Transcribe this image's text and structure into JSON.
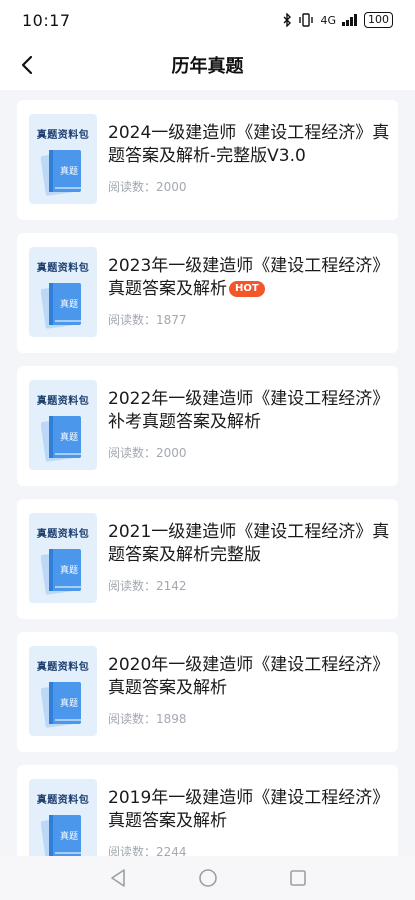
{
  "status_bar": {
    "time": "10:17",
    "network": "4G",
    "battery": "100"
  },
  "header": {
    "title": "历年真题",
    "back_icon": "chevron-left-icon"
  },
  "thumbnail": {
    "label": "真题资料包",
    "book_text": "真题"
  },
  "read_prefix": "阅读数：",
  "hot_label": "HOT",
  "items": [
    {
      "title": "2024一级建造师《建设工程经济》真题答案及解析-完整版V3.0",
      "reads": "2000",
      "hot": false
    },
    {
      "title": "2023年一级建造师《建设工程经济》真题答案及解析",
      "reads": "1877",
      "hot": true
    },
    {
      "title": "2022年一级建造师《建设工程经济》补考真题答案及解析",
      "reads": "2000",
      "hot": false
    },
    {
      "title": "2021一级建造师《建设工程经济》真题答案及解析完整版",
      "reads": "2142",
      "hot": false
    },
    {
      "title": "2020年一级建造师《建设工程经济》真题答案及解析",
      "reads": "1898",
      "hot": false
    },
    {
      "title": "2019年一级建造师《建设工程经济》真题答案及解析",
      "reads": "2244",
      "hot": false
    }
  ],
  "colors": {
    "hot_badge": "#f2562a",
    "thumb_bg": "#e3f0fc",
    "book_blue": "#4a97ec",
    "page_bg": "#f3f5f8"
  }
}
